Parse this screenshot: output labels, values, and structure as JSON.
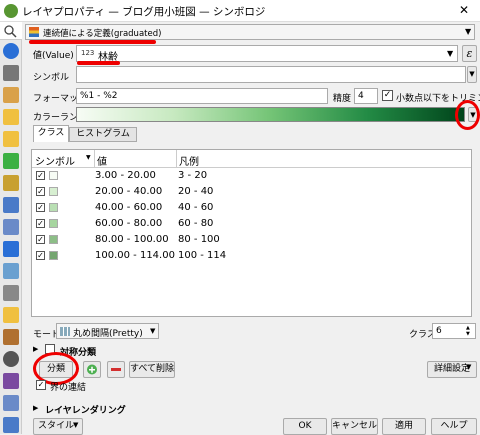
{
  "window": {
    "title": "レイヤプロパティ — ブログ用小班図 — シンボロジ",
    "close_glyph": "✕"
  },
  "renderer": {
    "selected": "連続値による定義(graduated)"
  },
  "value": {
    "label": "値(Value)",
    "type_badge": "123",
    "field": "林齢"
  },
  "symbol": {
    "label": "シンボル"
  },
  "format": {
    "label": "フォーマット",
    "value": "%1 - %2",
    "precision_label": "精度",
    "precision": "4",
    "trim_label": "小数点以下をトリミング",
    "trim_checked": true
  },
  "color_ramp": {
    "label": "カラーランプ",
    "start_color": "#f7fcf5",
    "end_color": "#00441b"
  },
  "tabs": [
    {
      "label": "クラス",
      "active": true
    },
    {
      "label": "ヒストグラム",
      "active": false
    }
  ],
  "table": {
    "headers": [
      "シンボル",
      "値",
      "凡例"
    ],
    "rows": [
      {
        "value": "3.00 - 20.00",
        "legend": "3 - 20",
        "color": "#f7fcf5"
      },
      {
        "value": "20.00 - 40.00",
        "legend": "20 - 40",
        "color": "#d7efd1"
      },
      {
        "value": "40.00 - 60.00",
        "legend": "40 - 60",
        "color": "#b9dfb3"
      },
      {
        "value": "60.00 - 80.00",
        "legend": "60 - 80",
        "color": "#a6d59f"
      },
      {
        "value": "80.00 - 100.00",
        "legend": "80 - 100",
        "color": "#8dbe87"
      },
      {
        "value": "100.00 - 114.00",
        "legend": "100 - 114",
        "color": "#75a570"
      }
    ]
  },
  "mode": {
    "label": "モード",
    "value": "丸め間隔(Pretty)",
    "classes_label": "クラス",
    "classes": "6"
  },
  "symmetric": {
    "label": "対称分類"
  },
  "actions": {
    "classify": "分類",
    "delete_all": "すべて削除",
    "advanced": "詳細設定"
  },
  "link": {
    "label": "界の連結"
  },
  "layer_rendering": {
    "label": "レイヤレンダリング"
  },
  "footer": {
    "style": "スタイル",
    "ok": "OK",
    "cancel": "キャンセル",
    "apply": "適用",
    "help": "ヘルプ"
  }
}
